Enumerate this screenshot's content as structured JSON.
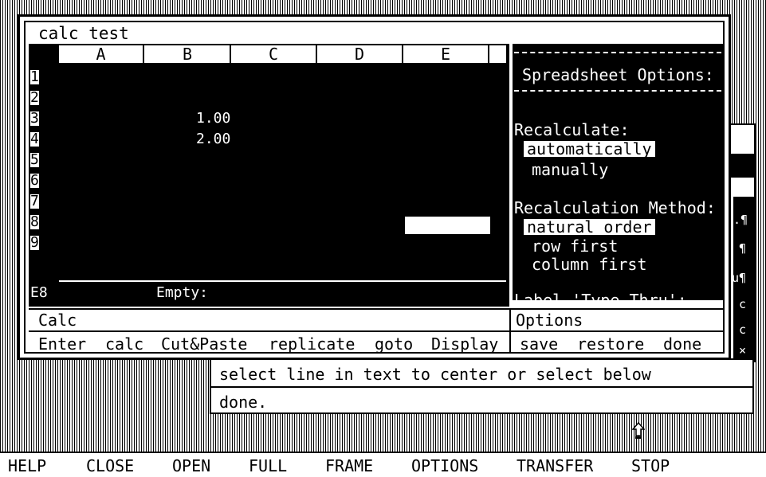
{
  "window": {
    "title": "calc test",
    "columns": [
      "A",
      "B",
      "C",
      "D",
      "E"
    ],
    "rows": [
      "1",
      "2",
      "3",
      "4",
      "5",
      "6",
      "7",
      "8",
      "9"
    ],
    "cells": [
      {
        "ref": "B3",
        "value": "1.00"
      },
      {
        "ref": "B4",
        "value": "2.00"
      }
    ],
    "selected_cell": "E8",
    "status": {
      "cell": "E8",
      "content": "Empty:"
    },
    "mode_label": "Calc",
    "commands": [
      "Enter",
      "calc",
      "Cut&Paste",
      "replicate",
      "goto",
      "Display"
    ]
  },
  "options_panel": {
    "heading": "Spreadsheet Options:",
    "recalculate_label": "Recalculate:",
    "recalculate_options": [
      "automatically",
      "manually"
    ],
    "recalculate_selected": "automatically",
    "method_label": "Recalculation Method:",
    "method_options": [
      "natural order",
      "row first",
      "column first"
    ],
    "method_selected": "natural order",
    "cut_label": "Label 'Type Thru':",
    "mode_label": "Options",
    "commands": [
      "save",
      "restore",
      "done"
    ]
  },
  "side_window_glyphs": [
    ".¶",
    "¶",
    "u¶",
    "c",
    "c",
    "×"
  ],
  "prompt": {
    "line1": "select line in text to center or select below",
    "line2": "done."
  },
  "menu_bar": [
    "HELP",
    "CLOSE",
    "OPEN",
    "FULL",
    "FRAME",
    "OPTIONS",
    "TRANSFER",
    "STOP"
  ],
  "colors": {
    "background": "#000000",
    "foreground": "#ffffff"
  }
}
